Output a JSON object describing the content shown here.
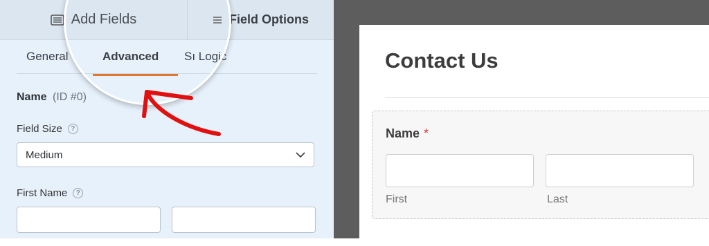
{
  "builder": {
    "top_tabs": {
      "add_fields": "Add Fields",
      "field_options": "Field Options"
    },
    "sub_tabs": {
      "general": "General",
      "advanced": "Advanced",
      "logic": "Sı Logic"
    },
    "field": {
      "name": "Name",
      "id": "(ID #0)"
    },
    "field_size": {
      "label": "Field Size",
      "help": "?",
      "value": "Medium"
    },
    "first_name": {
      "label": "First Name",
      "help": "?"
    }
  },
  "preview": {
    "title": "Contact Us",
    "name_field": {
      "label": "Name",
      "required_mark": "*",
      "first": "First",
      "last": "Last"
    }
  },
  "colors": {
    "accent_orange": "#e27730",
    "arrow_red": "#e01010",
    "required_red": "#d63638",
    "panel_blue": "#e7f1fb"
  }
}
